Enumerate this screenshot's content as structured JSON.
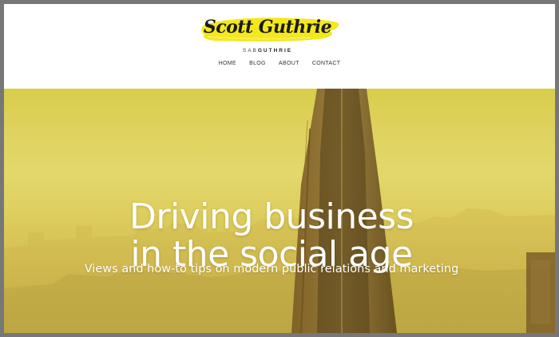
{
  "site": {
    "logo_title": "Scott Guthrie",
    "logo_sub_prefix": "SAB",
    "logo_sub_main": "GUTHRIE"
  },
  "nav": {
    "items": [
      "HOME",
      "BLOG",
      "ABOUT",
      "CONTACT"
    ]
  },
  "hero": {
    "title_line1": "Driving business",
    "title_line2": "in the social age",
    "subtitle": "Views and how-to tips on modern public relations and marketing"
  },
  "colors": {
    "brush": "#f3e81c",
    "hero_top": "#d6cb4a",
    "hero_bottom": "#b39c3c"
  }
}
